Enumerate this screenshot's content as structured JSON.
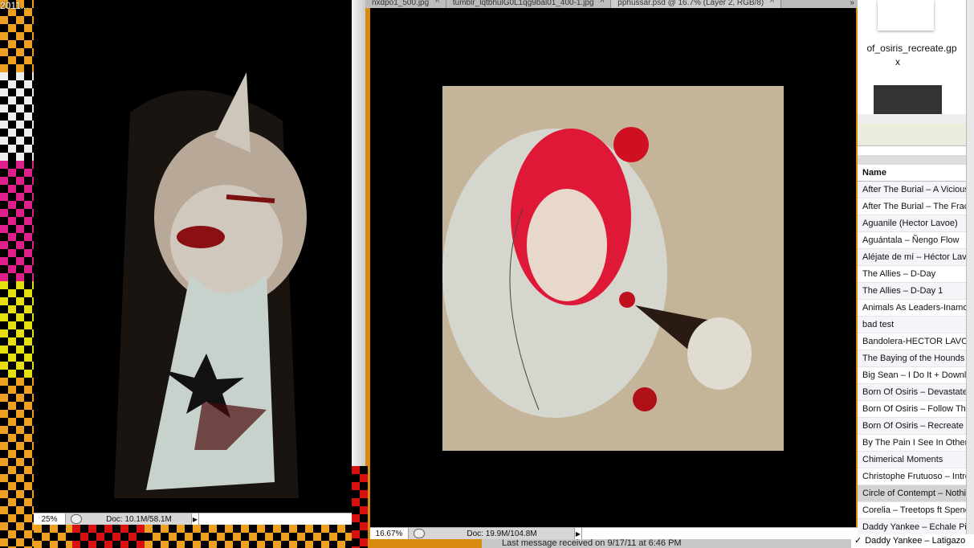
{
  "desktop": {
    "label": "2011..."
  },
  "left_window": {
    "zoom": "25%",
    "doc": "Doc: 10.1M/58.1M"
  },
  "right_window": {
    "tabs": [
      {
        "label": "nxdpo1_500.jpg"
      },
      {
        "label": "tumblr_lqtbhulG0L1qg9bal01_400-1.jpg"
      },
      {
        "label": "pphussar.psd @ 16.7% (Layer 2, RGB/8)"
      }
    ],
    "overflow": "»",
    "zoom": "16.67%",
    "doc": "Doc: 19.9M/104.8M"
  },
  "chat": {
    "status": "Last message received on 9/17/11 at 6:46 PM"
  },
  "finder": {
    "file_name": "of_osiris_recreate.gp",
    "file_name_2": "x"
  },
  "playlist": {
    "header": "Name",
    "rows": [
      "After The Burial – A Vicious",
      "After The Burial – The Fractal",
      "Aguanile (Hector Lavoe)",
      "Aguántala – Ñengo Flow",
      "Aléjate de mí – Héctor Lavoe",
      "The Allies – D-Day",
      "The Allies – D-Day 1",
      "Animals As Leaders-Inamorata",
      "bad test",
      "Bandolera-HECTOR LAVOE",
      "The Baying of the Hounds",
      "Big Sean – I Do It + Download",
      "Born Of Osiris – Devastate",
      "Born Of Osiris – Follow The",
      "Born Of Osiris – Recreate",
      "By The Pain I See In Others",
      "Chimerical Moments",
      "Christophe Frutuoso – Intro",
      "Circle of Contempt – Nothing",
      "Corelia – Treetops ft Spencer",
      "Daddy Yankee – Echale Pique"
    ],
    "last_row": "Daddy Yankee – Latigazo",
    "selected_index": 18
  }
}
